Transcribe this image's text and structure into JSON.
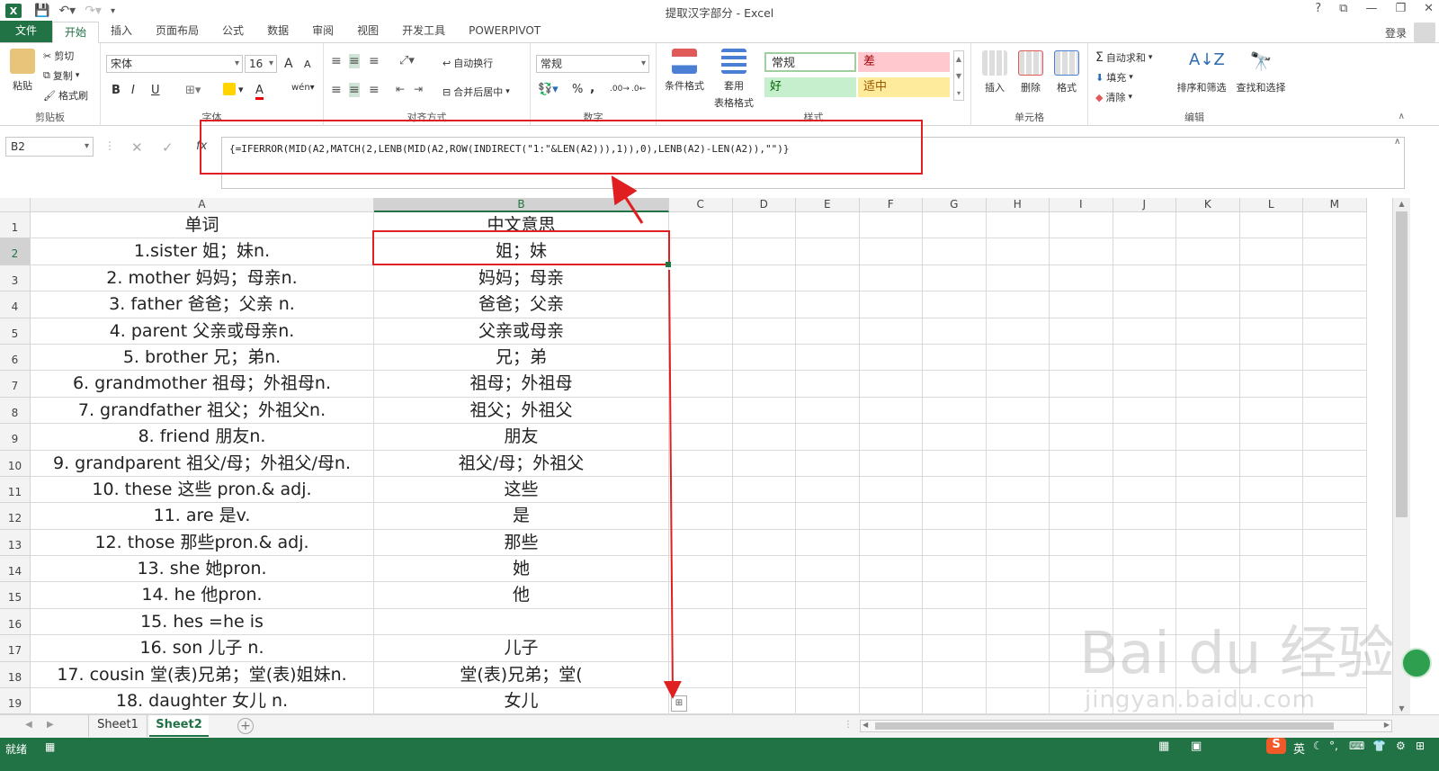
{
  "window": {
    "title": "提取汉字部分 - Excel",
    "app_logo": "X",
    "controls": [
      "?",
      "⧉",
      "—",
      "❐",
      "✕"
    ]
  },
  "tabs": [
    "文件",
    "开始",
    "插入",
    "页面布局",
    "公式",
    "数据",
    "审阅",
    "视图",
    "开发工具",
    "POWERPIVOT"
  ],
  "login": "登录",
  "ribbon": {
    "clipboard": {
      "paste": "粘贴",
      "cut": "剪切",
      "copy": "复制",
      "format_painter": "格式刷",
      "label": "剪贴板"
    },
    "font": {
      "name": "宋体",
      "size": "16",
      "label": "字体",
      "bold": "B",
      "italic": "I",
      "underline": "U",
      "grow": "A",
      "shrink": "A",
      "color": "A"
    },
    "alignment": {
      "wrap": "自动换行",
      "merge": "合并后居中",
      "label": "对齐方式"
    },
    "number": {
      "format": "常规",
      "percent": "%",
      "comma": ",",
      "label": "数字"
    },
    "styles": {
      "conditional": "条件格式",
      "table_line1": "套用",
      "table_line2": "表格格式",
      "normal": "常规",
      "bad": "差",
      "good": "好",
      "neutral": "适中",
      "label": "样式"
    },
    "cells": {
      "insert": "插入",
      "delete": "删除",
      "format": "格式",
      "label": "单元格"
    },
    "editing": {
      "autosum": "自动求和",
      "fill": "填充",
      "clear": "清除",
      "sort": "排序和筛选",
      "find": "查找和选择",
      "label": "编辑"
    }
  },
  "formula_bar": {
    "name_box": "B2",
    "fx": "fx",
    "formula": "{=IFERROR(MID(A2,MATCH(2,LENB(MID(A2,ROW(INDIRECT(\"1:\"&LEN(A2))),1)),0),LENB(A2)-LEN(A2)),\"\")}"
  },
  "columns": [
    "A",
    "B",
    "C",
    "D",
    "E",
    "F",
    "G",
    "H",
    "I",
    "J",
    "K",
    "L",
    "M"
  ],
  "rows": [
    {
      "n": "1",
      "a": "单词",
      "b": "中文意思"
    },
    {
      "n": "2",
      "a": "1.sister 姐；妹n.",
      "b": "姐；妹"
    },
    {
      "n": "3",
      "a": "2. mother 妈妈；母亲n.",
      "b": "妈妈；母亲"
    },
    {
      "n": "4",
      "a": "3. father 爸爸；父亲 n.",
      "b": "爸爸；父亲"
    },
    {
      "n": "5",
      "a": "4. parent 父亲或母亲n.",
      "b": "父亲或母亲"
    },
    {
      "n": "6",
      "a": "5. brother 兄；弟n.",
      "b": "兄；弟"
    },
    {
      "n": "7",
      "a": "6. grandmother 祖母；外祖母n.",
      "b": "祖母；外祖母"
    },
    {
      "n": "8",
      "a": "7. grandfather 祖父；外祖父n.",
      "b": "祖父；外祖父"
    },
    {
      "n": "9",
      "a": "8. friend 朋友n.",
      "b": "朋友"
    },
    {
      "n": "10",
      "a": "9. grandparent 祖父/母；外祖父/母n.",
      "b": "祖父/母；外祖父"
    },
    {
      "n": "11",
      "a": "10. these 这些 pron.& adj.",
      "b": "这些"
    },
    {
      "n": "12",
      "a": "11. are 是v.",
      "b": "是"
    },
    {
      "n": "13",
      "a": "12. those 那些pron.& adj.",
      "b": "那些"
    },
    {
      "n": "14",
      "a": "13. she 她pron.",
      "b": "她"
    },
    {
      "n": "15",
      "a": "14. he 他pron.",
      "b": "他"
    },
    {
      "n": "16",
      "a": "15. hes =he is",
      "b": ""
    },
    {
      "n": "17",
      "a": "16. son 儿子 n.",
      "b": "儿子"
    },
    {
      "n": "18",
      "a": "17. cousin 堂(表)兄弟；堂(表)姐妹n.",
      "b": "堂(表)兄弟；堂("
    },
    {
      "n": "19",
      "a": "18. daughter 女儿 n.",
      "b": "女儿"
    }
  ],
  "sheets": [
    "Sheet1",
    "Sheet2"
  ],
  "active_sheet": "Sheet2",
  "status": {
    "ready": "就绪",
    "ime": "英"
  },
  "watermark": {
    "brand": "Bai du 经验",
    "url": "jingyan.baidu.com"
  },
  "colors": {
    "excel_green": "#217346",
    "annotation_red": "#e02020"
  }
}
